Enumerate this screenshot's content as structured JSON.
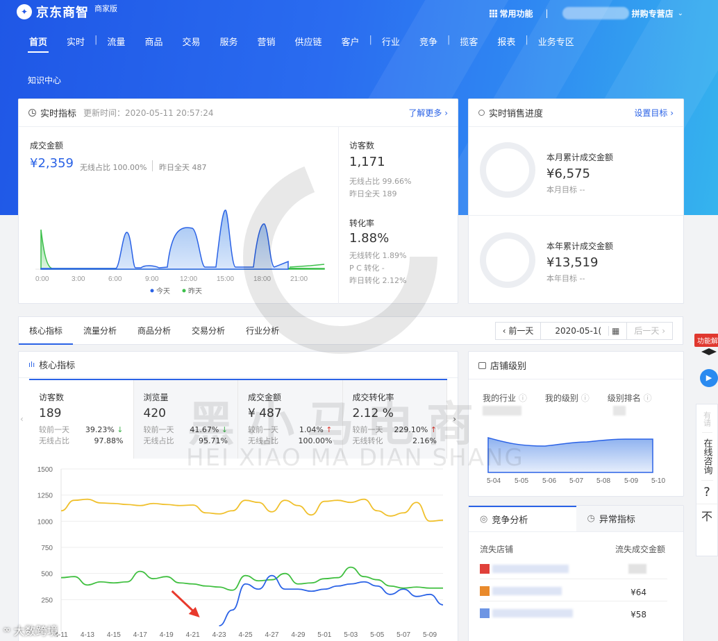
{
  "header": {
    "brand": "京东商智",
    "brand_sub": "商家版",
    "common_functions": "常用功能",
    "shop_name": "拼购专营店",
    "nav": [
      "首页",
      "实时",
      "流量",
      "商品",
      "交易",
      "服务",
      "营销",
      "供应链",
      "客户",
      "行业",
      "竞争",
      "揽客",
      "报表",
      "业务专区"
    ],
    "knowledge_center": "知识中心"
  },
  "realtime": {
    "title": "实时指标",
    "update_time": "更新时间：2020-05-11 20:57:24",
    "learn_more": "了解更多",
    "gmv_label": "成交金额",
    "gmv_value": "¥2,359",
    "gmv_wireless_share": "无线占比 100.00%",
    "gmv_yesterday": "昨日全天 487",
    "visitors_label": "访客数",
    "visitors_value": "1,171",
    "visitors_wireless": "无线占比 99.66%",
    "visitors_yesterday": "昨日全天 189",
    "conv_label": "转化率",
    "conv_value": "1.88%",
    "conv_wireless": "无线转化 1.89%",
    "conv_pc": "P C 转化 -",
    "conv_yesterday": "昨日转化 2.12%",
    "legend_today": "今天",
    "legend_yesterday": "昨天",
    "x_ticks": [
      "0:00",
      "3:00",
      "6:00",
      "9:00",
      "12:00",
      "15:00",
      "18:00",
      "21:00"
    ]
  },
  "sales_progress": {
    "title": "实时销售进度",
    "set_target": "设置目标",
    "month_label": "本月累计成交金额",
    "month_value": "¥6,575",
    "month_target": "本月目标 --",
    "year_label": "本年累计成交金额",
    "year_value": "¥13,519",
    "year_target": "本年目标 --"
  },
  "analysis_tabs": [
    "核心指标",
    "流量分析",
    "商品分析",
    "交易分析",
    "行业分析"
  ],
  "date_ctrl": {
    "prev": "‹ 前一天",
    "date": "2020-05-1(",
    "next": "后一天 ›"
  },
  "core": {
    "title": "核心指标",
    "kpis": [
      {
        "label": "访客数",
        "value": "189",
        "cmp_label": "较前一天",
        "cmp": "39.23%",
        "dir": "↓",
        "share_label": "无线占比",
        "share": "97.88%"
      },
      {
        "label": "浏览量",
        "value": "420",
        "cmp_label": "较前一天",
        "cmp": "41.67%",
        "dir": "↓",
        "share_label": "无线占比",
        "share": "95.71%"
      },
      {
        "label": "成交金额",
        "value": "¥ 487",
        "cmp_label": "较前一天",
        "cmp": "1.04%",
        "dir": "↑",
        "share_label": "无线占比",
        "share": "100.00%"
      },
      {
        "label": "成交转化率",
        "value": "2.12 %",
        "cmp_label": "较前一天",
        "cmp": "229.10%",
        "dir": "↑",
        "share_label": "无线转化",
        "share": "2.16%"
      }
    ],
    "y_ticks": [
      "1500",
      "1250",
      "1000",
      "750",
      "500",
      "250"
    ],
    "x_ticks": [
      "4-11",
      "4-13",
      "4-15",
      "4-17",
      "4-19",
      "4-21",
      "4-23",
      "4-25",
      "4-27",
      "4-29",
      "5-01",
      "5-03",
      "5-05",
      "5-07",
      "5-09"
    ]
  },
  "chart_data": {
    "type": "line",
    "title": "",
    "x": [
      "4-11",
      "4-12",
      "4-13",
      "4-14",
      "4-15",
      "4-16",
      "4-17",
      "4-18",
      "4-19",
      "4-20",
      "4-21",
      "4-22",
      "4-23",
      "4-24",
      "4-25",
      "4-26",
      "4-27",
      "4-28",
      "4-29",
      "4-30",
      "5-01",
      "5-02",
      "5-03",
      "5-04",
      "5-05",
      "5-06",
      "5-07",
      "5-08",
      "5-09",
      "5-10"
    ],
    "ylim": [
      0,
      1500
    ],
    "series": [
      {
        "color": "#f0c02c",
        "values": [
          1100,
          1200,
          1210,
          1175,
          1170,
          1160,
          1150,
          1170,
          1160,
          1150,
          1155,
          1080,
          1070,
          1100,
          1200,
          1180,
          1090,
          1200,
          1150,
          1060,
          1190,
          1200,
          1180,
          1210,
          1100,
          1050,
          1080,
          1180,
          1000,
          1010
        ]
      },
      {
        "color": "#3fbf3f",
        "values": [
          460,
          470,
          390,
          420,
          410,
          420,
          520,
          450,
          470,
          410,
          400,
          380,
          370,
          340,
          480,
          430,
          440,
          500,
          400,
          410,
          450,
          460,
          560,
          470,
          440,
          380,
          360,
          370,
          360,
          360
        ]
      },
      {
        "color": "#2a62e6",
        "values": [
          null,
          null,
          null,
          null,
          null,
          null,
          null,
          null,
          null,
          null,
          null,
          null,
          0,
          150,
          400,
          350,
          480,
          350,
          350,
          330,
          350,
          380,
          400,
          420,
          380,
          300,
          350,
          280,
          300,
          200
        ]
      }
    ]
  },
  "shop_level": {
    "title": "店铺级别",
    "cols": [
      "我的行业",
      "我的级别",
      "级别排名"
    ],
    "x_ticks": [
      "5-04",
      "5-05",
      "5-06",
      "5-07",
      "5-08",
      "5-09",
      "5-10"
    ]
  },
  "competition": {
    "tab1": "竞争分析",
    "tab2": "异常指标",
    "col1": "流失店铺",
    "col2": "流失成交金额",
    "rows": [
      {
        "amount": ""
      },
      {
        "amount": "¥64"
      },
      {
        "amount": "¥58"
      }
    ]
  },
  "floating": {
    "badge": "功能解",
    "consult": "在线咨询",
    "help": "?",
    "faint": "有请"
  },
  "watermark": {
    "main": "黑小马电商",
    "pinyin": "HEI XIAO MA DIAN SHANG",
    "corner": "大数跨境"
  }
}
